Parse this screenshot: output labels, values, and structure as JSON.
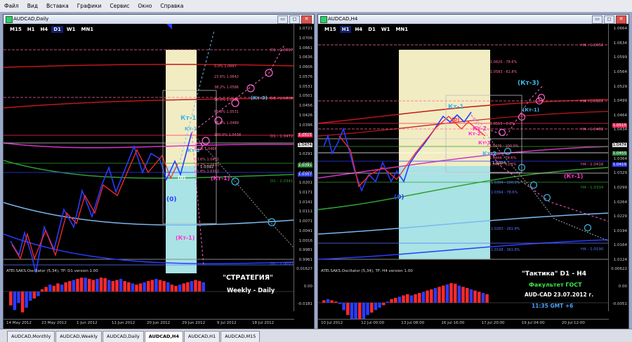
{
  "menu": [
    "Файл",
    "Вид",
    "Вставка",
    "Графики",
    "Сервис",
    "Окно",
    "Справка"
  ],
  "window_buttons": [
    "▭",
    "◻",
    "✕"
  ],
  "left": {
    "title": "AUDCAD,Daily",
    "timeframes": [
      "M15",
      "H1",
      "H4",
      "D1",
      "W1",
      "MN1"
    ],
    "active_tf": "D1",
    "prices": [
      "1.0721",
      "1.0706",
      "1.0661",
      "1.0636",
      "1.0606",
      "1.0576",
      "1.0531",
      "1.0501",
      "1.0456",
      "1.0426",
      "1.0396",
      "1.0366",
      "1.0321",
      "1.0291",
      "1.0261",
      "1.0231",
      "1.0201",
      "1.0171",
      "1.0141",
      "1.0111",
      "1.0071",
      "1.0041",
      "1.0016",
      "0.9981",
      "0.9961"
    ],
    "price_tags": [
      "1.0515",
      "1.0474",
      "1.0391",
      "1.0357"
    ],
    "dates": [
      "14 May 2012",
      "23 May 2012",
      "1 Jun 2012",
      "11 Jun 2012",
      "20 Jun 2012",
      "29 Jun 2012",
      "9 Jul 2012",
      "18 Jul 2012"
    ],
    "levels": [
      "D1 - 1.0697",
      "D1 - 1.0638",
      "D1 - 1.0472",
      "D1 - 1.0341",
      "D1 - 1.0003"
    ],
    "fib_labels": [
      "0.0% 1.0697",
      "23.6% 1.0642",
      "38.2% 1.0586",
      "50.0% 1.0555",
      "61.8% 1.0531",
      "78.6% 1.0489",
      "100.0% 1.0438",
      "0.0% 1.0466",
      "23.6% 1.0431",
      "38.2% 1.0411",
      "61.8% 1.0392"
    ],
    "value_label": "1.0392",
    "marks": [
      "Кт-1",
      "Кт-1",
      "Кт-2",
      "(Кт-3)",
      "(0)",
      "(0)",
      "(Кт-1)",
      "(Кт-1)"
    ],
    "osc_title": "ATEI.SAKS.Oscillator (5,34), TF: D1  version 1.00",
    "osc_ticks": [
      "0.01627",
      "0.00",
      "-0.0181"
    ],
    "caption1": "\"СТРАТЕГИЯ\"",
    "caption2": "Weekly - Daily"
  },
  "right": {
    "title": "AUDCAD,H4",
    "timeframes": [
      "M15",
      "H1",
      "H4",
      "D1",
      "W1",
      "MN1"
    ],
    "active_tf": "H1",
    "prices": [
      "1.0664",
      "1.0634",
      "1.0599",
      "1.0564",
      "1.0529",
      "1.0499",
      "1.0464",
      "1.0434",
      "1.0399",
      "1.0364",
      "1.0329",
      "1.0299",
      "1.0264",
      "1.0229",
      "1.0194",
      "1.0164",
      "1.0124"
    ],
    "price_tags": [
      "1.0515",
      "1.0474",
      "1.0455",
      "1.0419"
    ],
    "dates": [
      "10 Jul 2012",
      "12 Jul 00:00",
      "13 Jul 08:00",
      "16 Jul 16:00",
      "17 Jul 20:00",
      "19 Jul 04:00",
      "20 Jul 12:00"
    ],
    "levels": [
      "H4 - 1.0652",
      "H4 - 1.0567",
      "H4 - 1.0482",
      "H4 - 1.0416",
      "H4 - 1.0334",
      "H4 - 1.0190"
    ],
    "fib_labels": [
      "1.0620 - 78.6%",
      "1.0583 - 61.8%",
      "1.0515 - 0.0%",
      "1.0476 - 100.0%",
      "1.0444 - 78.6%",
      "1.0433 - 61.8%",
      "1.0394 - 100.0%",
      "1.0394 - 78.6%",
      "1.0283 - 261.8%",
      "1.0198 - 361.8%"
    ],
    "value_label": "1.0394",
    "marks": [
      "Кт-1",
      "(0)",
      "Кт-2",
      "Кт-2",
      "Кт-3",
      "Кт-2",
      "(Кт-3)",
      "(Кт-1)",
      "(Кт-1)",
      "(0)"
    ],
    "osc_title": "ATEI.SAKS.Oscillator (5,34), TF: H4  version 1.00",
    "osc_ticks": [
      "0.00622",
      "0.00",
      "-0.0051"
    ],
    "caption1": "\"Тактика\"  D1 - H4",
    "caption2": "Факультет ГОСТ",
    "caption3": "AUD-CAD  23.07.2012  г.",
    "caption4": "11:35   GMT +6"
  },
  "tabs": [
    "AUDCAD,Monthly",
    "AUDCAD,Weekly",
    "AUDCAD,Daily",
    "AUDCAD,H4",
    "AUDCAD,H1",
    "AUDCAD,M15"
  ],
  "active_tab": "AUDCAD,H4",
  "colors": {
    "blue_wave": "#2a3cff",
    "red_wave": "#ff2a2a",
    "magenta": "#ff33cc",
    "cyan": "#3fb7e8",
    "fib_pink": "#ff6699"
  }
}
